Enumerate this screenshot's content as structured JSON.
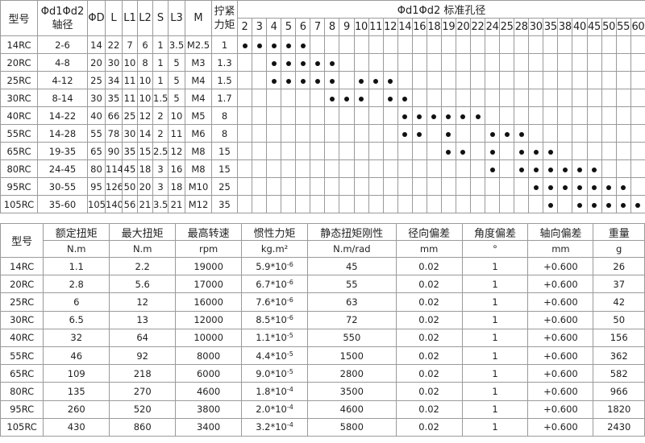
{
  "size_table": {
    "headers": {
      "model": "型号",
      "bore_top": "Φd1Φd2",
      "bore_bottom": "轴径",
      "D": "ΦD",
      "L": "L",
      "L1": "L1",
      "L2": "L2",
      "S": "S",
      "L3": "L3",
      "M": "M",
      "torque_top": "拧紧",
      "torque_bottom": "力矩",
      "std_bore_title": "Φd1Φd2 标准孔径"
    },
    "diameters": [
      "2",
      "3",
      "4",
      "5",
      "6",
      "7",
      "8",
      "9",
      "10",
      "11",
      "12",
      "14",
      "16",
      "18",
      "19",
      "20",
      "22",
      "24",
      "25",
      "28",
      "30",
      "35",
      "38",
      "40",
      "45",
      "50",
      "55",
      "60"
    ],
    "rows": [
      {
        "model": "14RC",
        "bore": "2-6",
        "D": "14",
        "L": "22",
        "L1": "7",
        "L2": "6",
        "S": "1",
        "L3": "3.5",
        "M": "M2.5",
        "torque": "1",
        "dots": [
          "2",
          "3",
          "4",
          "5",
          "6"
        ]
      },
      {
        "model": "20RC",
        "bore": "4-8",
        "D": "20",
        "L": "30",
        "L1": "10",
        "L2": "8",
        "S": "1",
        "L3": "5",
        "M": "M3",
        "torque": "1.3",
        "dots": [
          "4",
          "5",
          "6",
          "7",
          "8"
        ]
      },
      {
        "model": "25RC",
        "bore": "4-12",
        "D": "25",
        "L": "34",
        "L1": "11",
        "L2": "10",
        "S": "1",
        "L3": "5",
        "M": "M4",
        "torque": "1.5",
        "dots": [
          "4",
          "5",
          "6",
          "7",
          "8",
          "10",
          "11",
          "12"
        ]
      },
      {
        "model": "30RC",
        "bore": "8-14",
        "D": "30",
        "L": "35",
        "L1": "11",
        "L2": "10",
        "S": "1.5",
        "L3": "5",
        "M": "M4",
        "torque": "1.7",
        "dots": [
          "8",
          "9",
          "10",
          "12",
          "14"
        ]
      },
      {
        "model": "40RC",
        "bore": "14-22",
        "D": "40",
        "L": "66",
        "L1": "25",
        "L2": "12",
        "S": "2",
        "L3": "10",
        "M": "M5",
        "torque": "8",
        "dots": [
          "14",
          "16",
          "18",
          "19",
          "20",
          "22"
        ]
      },
      {
        "model": "55RC",
        "bore": "14-28",
        "D": "55",
        "L": "78",
        "L1": "30",
        "L2": "14",
        "S": "2",
        "L3": "11",
        "M": "M6",
        "torque": "8",
        "dots": [
          "14",
          "16",
          "19",
          "24",
          "25",
          "28"
        ]
      },
      {
        "model": "65RC",
        "bore": "19-35",
        "D": "65",
        "L": "90",
        "L1": "35",
        "L2": "15",
        "S": "2.5",
        "L3": "12",
        "M": "M8",
        "torque": "15",
        "dots": [
          "19",
          "20",
          "24",
          "28",
          "30",
          "35"
        ]
      },
      {
        "model": "80RC",
        "bore": "24-45",
        "D": "80",
        "L": "114",
        "L1": "45",
        "L2": "18",
        "S": "3",
        "L3": "16",
        "M": "M8",
        "torque": "15",
        "dots": [
          "24",
          "28",
          "30",
          "35",
          "38",
          "40",
          "45"
        ]
      },
      {
        "model": "95RC",
        "bore": "30-55",
        "D": "95",
        "L": "126",
        "L1": "50",
        "L2": "20",
        "S": "3",
        "L3": "18",
        "M": "M10",
        "torque": "25",
        "dots": [
          "30",
          "35",
          "38",
          "40",
          "45",
          "50",
          "55"
        ]
      },
      {
        "model": "105RC",
        "bore": "35-60",
        "D": "105",
        "L": "140",
        "L1": "56",
        "L2": "21",
        "S": "3.5",
        "L3": "21",
        "M": "M12",
        "torque": "35",
        "dots": [
          "35",
          "40",
          "45",
          "50",
          "55",
          "60"
        ]
      }
    ]
  },
  "perf_table": {
    "headers": [
      "型号",
      "额定扭矩",
      "最大扭矩",
      "最高转速",
      "惯性力矩",
      "静态扭矩刚性",
      "径向偏差",
      "角度偏差",
      "轴向偏差",
      "重量"
    ],
    "units": [
      "",
      "N.m",
      "N.m",
      "rpm",
      "kg.m²",
      "N.m/rad",
      "mm",
      "°",
      "mm",
      "g"
    ],
    "rows": [
      {
        "model": "14RC",
        "rated": "1.1",
        "max": "2.2",
        "speed": "19000",
        "inertia_base": "5.9*10",
        "inertia_exp": "-6",
        "stiff": "45",
        "radial": "0.02",
        "angle": "1",
        "axial": "+0.600",
        "weight": "26"
      },
      {
        "model": "20RC",
        "rated": "2.8",
        "max": "5.6",
        "speed": "17000",
        "inertia_base": "6.7*10",
        "inertia_exp": "-6",
        "stiff": "55",
        "radial": "0.02",
        "angle": "1",
        "axial": "+0.600",
        "weight": "37"
      },
      {
        "model": "25RC",
        "rated": "6",
        "max": "12",
        "speed": "16000",
        "inertia_base": "7.6*10",
        "inertia_exp": "-6",
        "stiff": "63",
        "radial": "0.02",
        "angle": "1",
        "axial": "+0.600",
        "weight": "42"
      },
      {
        "model": "30RC",
        "rated": "6.5",
        "max": "13",
        "speed": "12000",
        "inertia_base": "8.5*10",
        "inertia_exp": "-6",
        "stiff": "72",
        "radial": "0.02",
        "angle": "1",
        "axial": "+0.600",
        "weight": "50"
      },
      {
        "model": "40RC",
        "rated": "32",
        "max": "64",
        "speed": "10000",
        "inertia_base": "1.1*10",
        "inertia_exp": "-5",
        "stiff": "550",
        "radial": "0.02",
        "angle": "1",
        "axial": "+0.600",
        "weight": "156"
      },
      {
        "model": "55RC",
        "rated": "46",
        "max": "92",
        "speed": "8000",
        "inertia_base": "4.4*10",
        "inertia_exp": "-5",
        "stiff": "1500",
        "radial": "0.02",
        "angle": "1",
        "axial": "+0.600",
        "weight": "362"
      },
      {
        "model": "65RC",
        "rated": "109",
        "max": "218",
        "speed": "6000",
        "inertia_base": "9.0*10",
        "inertia_exp": "-5",
        "stiff": "2800",
        "radial": "0.02",
        "angle": "1",
        "axial": "+0.600",
        "weight": "582"
      },
      {
        "model": "80RC",
        "rated": "135",
        "max": "270",
        "speed": "4600",
        "inertia_base": "1.8*10",
        "inertia_exp": "-4",
        "stiff": "3500",
        "radial": "0.02",
        "angle": "1",
        "axial": "+0.600",
        "weight": "966"
      },
      {
        "model": "95RC",
        "rated": "260",
        "max": "520",
        "speed": "3800",
        "inertia_base": "2.0*10",
        "inertia_exp": "-4",
        "stiff": "4600",
        "radial": "0.02",
        "angle": "1",
        "axial": "+0.600",
        "weight": "1820"
      },
      {
        "model": "105RC",
        "rated": "430",
        "max": "860",
        "speed": "3400",
        "inertia_base": "3.2*10",
        "inertia_exp": "-4",
        "stiff": "5800",
        "radial": "0.02",
        "angle": "1",
        "axial": "+0.600",
        "weight": "2430"
      }
    ]
  },
  "colors": {
    "border": "#9a9a9a",
    "text": "#222222",
    "dot": "#111111"
  }
}
